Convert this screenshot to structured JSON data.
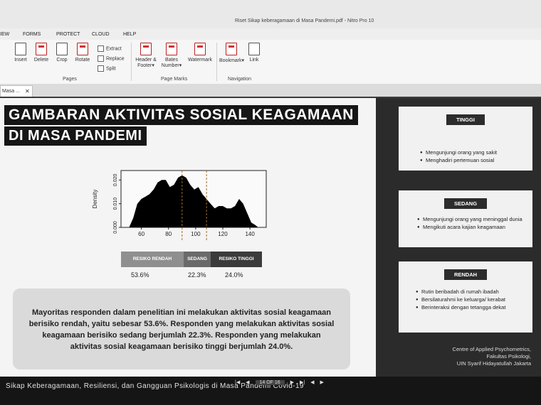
{
  "window": {
    "title": "Riset Sikap keberagamaan di Masa Pandemi.pdf - Nitro Pro 10"
  },
  "menu": {
    "items": [
      "IEW",
      "FORMS",
      "PROTECT",
      "CLOUD",
      "HELP"
    ]
  },
  "ribbon": {
    "pages_group": {
      "label": "Pages",
      "buttons": [
        {
          "label": "Insert",
          "icon": "insert-page-icon"
        },
        {
          "label": "Delete",
          "icon": "delete-page-icon"
        },
        {
          "label": "Crop",
          "icon": "crop-icon"
        },
        {
          "label": "Rotate",
          "icon": "rotate-icon"
        }
      ],
      "small_buttons": [
        {
          "label": "Extract",
          "icon": "extract-icon"
        },
        {
          "label": "Replace",
          "icon": "replace-icon"
        },
        {
          "label": "Split",
          "icon": "split-icon"
        }
      ]
    },
    "page_marks_group": {
      "label": "Page Marks",
      "buttons": [
        {
          "label": "Header &",
          "label2": "Footer",
          "icon": "header-footer-icon"
        },
        {
          "label": "Bates",
          "label2": "Number",
          "icon": "bates-number-icon"
        },
        {
          "label": "Watermark",
          "icon": "watermark-icon"
        }
      ]
    },
    "navigation_group": {
      "label": "Navigation",
      "buttons": [
        {
          "label": "Bookmark",
          "icon": "bookmark-icon"
        },
        {
          "label": "Link",
          "icon": "link-icon"
        }
      ]
    }
  },
  "tab": {
    "label": "Masa ...",
    "close": "✕"
  },
  "slide": {
    "title_line1": "GAMBARAN AKTIVITAS SOSIAL KEAGAMAAN",
    "title_line2": "DI MASA PANDEMI",
    "risk_segments": [
      {
        "label": "RESIKO RENDAH",
        "percent": "53.6%"
      },
      {
        "label": "SEDANG",
        "percent": "22.3%"
      },
      {
        "label": "RESIKO TINGGI",
        "percent": "24.0%"
      }
    ],
    "summary": "Mayoritas responden dalam penelitian ini melakukan aktivitas sosial keagamaan berisiko rendah, yaitu sebesar 53.6%. Responden yang melakukan aktivitas sosial keagamaan berisiko sedang berjumlah 22.3%. Responden yang melakukan aktivitas sosial keagamaan berisiko tinggi berjumlah 24.0%.",
    "cards": [
      {
        "label": "TINGGI",
        "items": [
          "Mengunjungi orang yang sakit",
          "Menghadiri pertemuan sosial"
        ]
      },
      {
        "label": "SEDANG",
        "items": [
          "Mengunjungi orang yang meninggal dunia",
          "Mengikuti acara kajian keagamaan"
        ]
      },
      {
        "label": "RENDAH",
        "items": [
          "Rutin beribadah di rumah ibadah",
          "Bersilaturahmi ke keluarga/ kerabat",
          "Berinteraksi dengan tetangga dekat"
        ]
      }
    ],
    "credits": [
      "Centre of Applied Psychometrics,",
      "Fakultas Psikologi,",
      "UIN Syarif Hidayatullah Jakarta"
    ],
    "footer_title": "Sikap Keberagamaan, Resiliensi, dan Gangguan Psikologis di Masa Pandemi Covid-19"
  },
  "pager": {
    "page_display": "14 OF 16"
  },
  "chart_data": {
    "type": "area",
    "title": "",
    "xlabel": "",
    "ylabel": "Density",
    "xlim": [
      45,
      152
    ],
    "ylim": [
      0,
      0.024
    ],
    "x_ticks": [
      60,
      80,
      100,
      120,
      140
    ],
    "y_ticks": [
      "0.000",
      "0.010",
      "0.020"
    ],
    "cutoffs": [
      90,
      108
    ],
    "fill": "#000000",
    "x": [
      51,
      54,
      57,
      60,
      63,
      66,
      69,
      72,
      75,
      78,
      81,
      84,
      87,
      90,
      93,
      96,
      99,
      102,
      105,
      108,
      111,
      114,
      117,
      120,
      123,
      126,
      129,
      132,
      135,
      138,
      141,
      144,
      146
    ],
    "y": [
      0.0,
      0.004,
      0.01,
      0.012,
      0.013,
      0.014,
      0.016,
      0.019,
      0.02,
      0.02,
      0.017,
      0.018,
      0.021,
      0.022,
      0.021,
      0.018,
      0.016,
      0.017,
      0.014,
      0.012,
      0.01,
      0.008,
      0.009,
      0.009,
      0.008,
      0.008,
      0.009,
      0.012,
      0.01,
      0.006,
      0.002,
      0.001,
      0.0
    ]
  }
}
